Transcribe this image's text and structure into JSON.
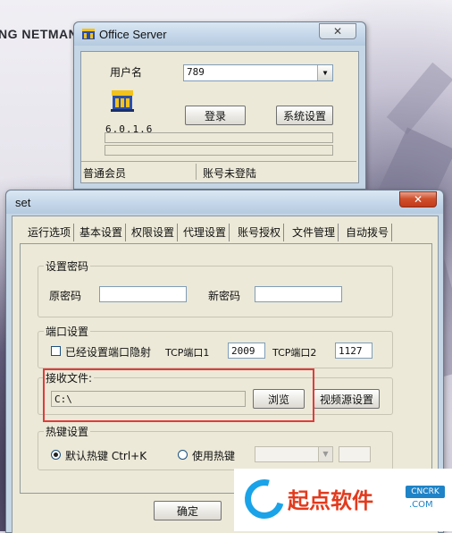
{
  "background": {
    "app_title_fragment": "NG NETMAN"
  },
  "login_window": {
    "title": "Office Server",
    "username_label": "用户名",
    "username_value": "789",
    "version": "6.0.1.6",
    "login_button": "登录",
    "settings_button": "系统设置",
    "status_left": "普通会员",
    "status_right": "账号未登陆",
    "close_label": "✕"
  },
  "set_window": {
    "title": "set",
    "close_label": "✕",
    "tabs": [
      "运行选项",
      "基本设置",
      "权限设置",
      "代理设置",
      "账号授权",
      "文件管理",
      "自动拨号"
    ],
    "active_tab": "基本设置",
    "password_group": {
      "title": "设置密码",
      "old_label": "原密码",
      "old_value": "",
      "new_label": "新密码",
      "new_value": ""
    },
    "port_group": {
      "title": "端口设置",
      "mapping_label": "已经设置端口隐射",
      "mapping_checked": false,
      "tcp1_label": "TCP端口1",
      "tcp1_value": "2009",
      "tcp2_label": "TCP端口2",
      "tcp2_value": "1127"
    },
    "receive_group": {
      "title": "接收文件:",
      "path_value": "C:\\",
      "browse_button": "浏览",
      "video_button": "视频源设置",
      "highlight_color": "#e23b3b"
    },
    "hotkey_group": {
      "title": "热键设置",
      "default_label": "默认热键 Ctrl+K",
      "default_checked": true,
      "custom_label": "使用热键",
      "custom_checked": false
    },
    "ok_button": "确定"
  },
  "watermark": {
    "brand": "起点软件",
    "badge": "CNCRK",
    "domain": ".COM"
  },
  "colors": {
    "window_frame": "#c5d6e6",
    "dialog_face": "#ece9d8",
    "close_red": "#c43a19",
    "watermark_red": "#e33a1d",
    "watermark_blue": "#1aa3e8"
  }
}
